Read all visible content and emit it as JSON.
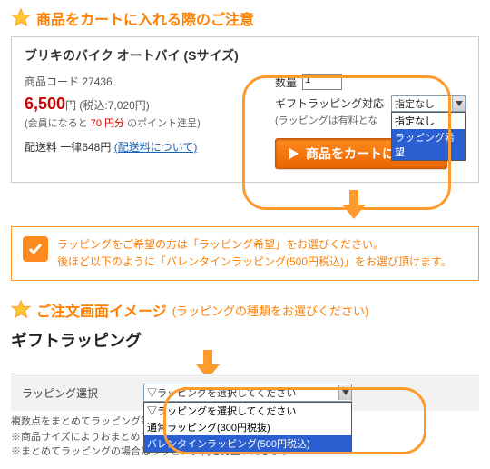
{
  "header1": {
    "title": "商品をカートに入れる際のご注意"
  },
  "product": {
    "name": "ブリキのバイク オートバイ (Sサイズ)",
    "code_label": "商品コード",
    "code": "27436",
    "price": "6,500",
    "price_unit": "円",
    "tax_in": "(税込:7,020円)",
    "member_prefix": "(会員になると ",
    "member_points": "70 円分",
    "member_suffix": " のポイント進呈)",
    "ship_label": "配送料 一律648円",
    "ship_link": "(配送料について)",
    "qty_label": "数量",
    "qty_value": "1",
    "gift_label": "ギフトラッピング対応",
    "gift_note": "(ラッピングは有料とな",
    "dropdown": {
      "selected": "指定なし",
      "opt1": "指定なし",
      "opt2": "ラッピング希望"
    },
    "cart_button": "商品をカートに入れる"
  },
  "notice": {
    "line1": "ラッピングをご希望の方は「ラッピング希望」をお選びください。",
    "line2": "後ほど以下のように「バレンタインラッピング(500円税込)」をお選び頂けます。"
  },
  "header2": {
    "title": "ご注文画面イメージ",
    "subtitle": "(ラッピングの種類をお選びください)"
  },
  "wrapping": {
    "heading": "ギフトラッピング",
    "row_label": "ラッピング選択",
    "selected": "▽ラッピングを選択してください",
    "opt1": "▽ラッピングを選択してください",
    "opt2": "通常ラッピング(300円税抜)",
    "opt3": "バレンタインラッピング(500円税込)"
  },
  "footer": {
    "l1": "複数点をまとめてラッピング等、",
    "l2": "※商品サイズによりおまとめできない場合もございます",
    "l3": "※まとめてラッピングの場合はラッピング代を訂正いたします"
  }
}
